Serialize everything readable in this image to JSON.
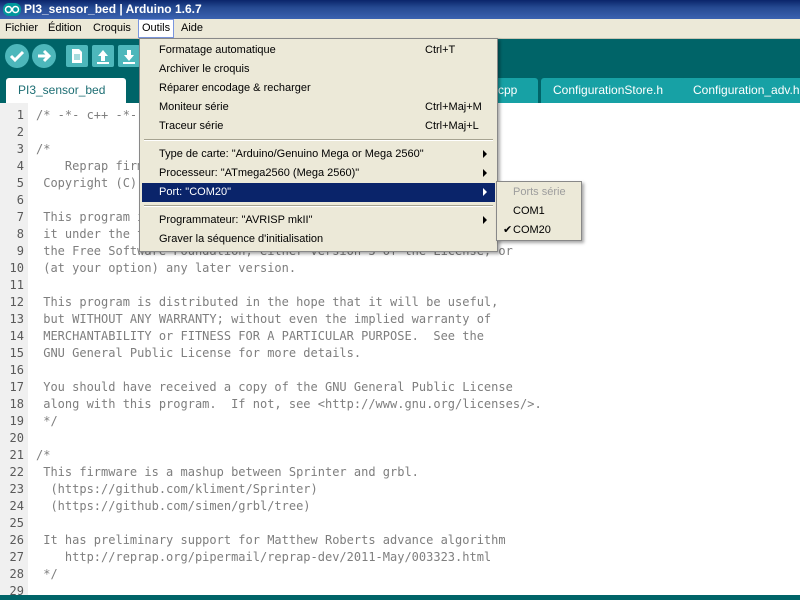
{
  "window": {
    "title": "PI3_sensor_bed | Arduino 1.6.7",
    "app_icon": "arduino-infinity-logo"
  },
  "menubar": [
    "Fichier",
    "Édition",
    "Croquis",
    "Outils",
    "Aide"
  ],
  "toolbar": {
    "buttons": [
      "verify-check-icon",
      "upload-arrow-icon",
      "new-file-icon",
      "open-arrow-up-icon",
      "save-arrow-down-icon"
    ]
  },
  "tabs": [
    {
      "label": "PI3_sensor_bed",
      "active": true
    },
    {
      "label": "e.cpp"
    },
    {
      "label": "ConfigurationStore.h"
    },
    {
      "label": "Configuration_adv.h"
    }
  ],
  "outils_menu": {
    "items": [
      {
        "label": "Formatage automatique",
        "shortcut": "Ctrl+T"
      },
      {
        "label": "Archiver le croquis"
      },
      {
        "label": "Réparer encodage & recharger"
      },
      {
        "label": "Moniteur série",
        "shortcut": "Ctrl+Maj+M"
      },
      {
        "label": "Traceur série",
        "shortcut": "Ctrl+Maj+L"
      },
      {
        "label": "Type de carte: \"Arduino/Genuino Mega or Mega 2560\"",
        "submenu": true
      },
      {
        "label": "Processeur: \"ATmega2560 (Mega 2560)\"",
        "submenu": true
      },
      {
        "label": "Port: \"COM20\"",
        "submenu": true,
        "highlighted": true
      },
      {
        "label": "Programmateur: \"AVRISP mkII\"",
        "submenu": true
      },
      {
        "label": "Graver la séquence d'initialisation"
      }
    ]
  },
  "port_submenu": {
    "header": "Ports série",
    "items": [
      {
        "label": "COM1",
        "checked": false
      },
      {
        "label": "COM20",
        "checked": true
      }
    ],
    "check_glyph": "✔"
  },
  "editor": {
    "lines": [
      {
        "n": "1",
        "text": "/* -*- c++ -*- */"
      },
      {
        "n": "2",
        "text": ""
      },
      {
        "n": "3",
        "text": "/*"
      },
      {
        "n": "4",
        "text": "    Reprap firmware based on Sprinter and grbl."
      },
      {
        "n": "5",
        "text": " Copyright (C) 2011 Camiel Gubbels / Erik van der Zalm"
      },
      {
        "n": "6",
        "text": ""
      },
      {
        "n": "7",
        "text": " This program is free software: you can redistribute it and/or modify"
      },
      {
        "n": "8",
        "text": " it under the terms of the GNU General Public License as published by"
      },
      {
        "n": "9",
        "text": " the Free Software Foundation, either version 3 of the License, or"
      },
      {
        "n": "10",
        "text": " (at your option) any later version."
      },
      {
        "n": "11",
        "text": ""
      },
      {
        "n": "12",
        "text": " This program is distributed in the hope that it will be useful,"
      },
      {
        "n": "13",
        "text": " but WITHOUT ANY WARRANTY; without even the implied warranty of"
      },
      {
        "n": "14",
        "text": " MERCHANTABILITY or FITNESS FOR A PARTICULAR PURPOSE.  See the"
      },
      {
        "n": "15",
        "text": " GNU General Public License for more details."
      },
      {
        "n": "16",
        "text": ""
      },
      {
        "n": "17",
        "text": " You should have received a copy of the GNU General Public License"
      },
      {
        "n": "18",
        "text": " along with this program.  If not, see <http://www.gnu.org/licenses/>."
      },
      {
        "n": "19",
        "text": " */"
      },
      {
        "n": "20",
        "text": ""
      },
      {
        "n": "21",
        "text": "/*"
      },
      {
        "n": "22",
        "text": " This firmware is a mashup between Sprinter and grbl."
      },
      {
        "n": "23",
        "text": "  (https://github.com/kliment/Sprinter)"
      },
      {
        "n": "24",
        "text": "  (https://github.com/simen/grbl/tree)"
      },
      {
        "n": "25",
        "text": ""
      },
      {
        "n": "26",
        "text": " It has preliminary support for Matthew Roberts advance algorithm"
      },
      {
        "n": "27",
        "text": "    http://reprap.org/pipermail/reprap-dev/2011-May/003323.html"
      },
      {
        "n": "28",
        "text": " */"
      },
      {
        "n": "29",
        "text": ""
      }
    ]
  },
  "colors": {
    "toolbar_bg": "#006468",
    "tab_bg": "#17a1a5",
    "menu_highlight": "#0a246a"
  }
}
